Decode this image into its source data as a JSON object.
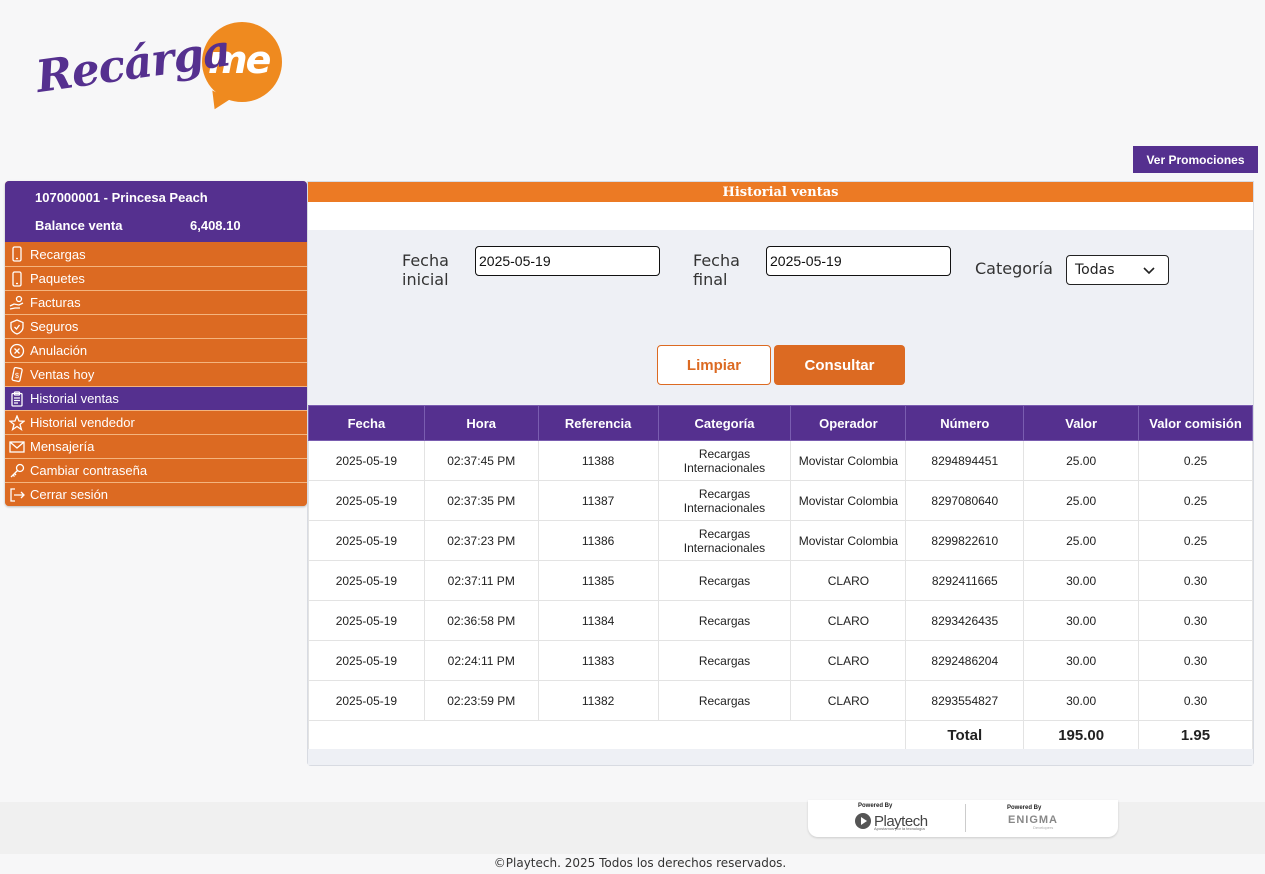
{
  "brand": {
    "logo_main": "Recárga",
    "logo_accent": "me"
  },
  "header": {
    "promo_button": "Ver Promociones"
  },
  "sidebar": {
    "account": "107000001 - Princesa Peach",
    "balance_label": "Balance venta",
    "balance_value": "6,408.10",
    "items": [
      {
        "label": "Recargas",
        "icon": "phone-icon"
      },
      {
        "label": "Paquetes",
        "icon": "phone-icon"
      },
      {
        "label": "Facturas",
        "icon": "hand-money-icon"
      },
      {
        "label": "Seguros",
        "icon": "shield-icon"
      },
      {
        "label": "Anulación",
        "icon": "circle-x-icon"
      },
      {
        "label": "Ventas hoy",
        "icon": "money-hand-icon"
      },
      {
        "label": "Historial ventas",
        "icon": "clipboard-icon",
        "active": true
      },
      {
        "label": "Historial vendedor",
        "icon": "star-icon"
      },
      {
        "label": "Mensajería",
        "icon": "envelope-icon"
      },
      {
        "label": "Cambiar contraseña",
        "icon": "key-icon"
      },
      {
        "label": "Cerrar sesión",
        "icon": "logout-icon"
      }
    ]
  },
  "panel": {
    "title": "Historial ventas",
    "filters": {
      "start_label_1": "Fecha",
      "start_label_2": "inicial",
      "start_value": "2025-05-19",
      "end_label_1": "Fecha",
      "end_label_2": "final",
      "end_value": "2025-05-19",
      "category_label": "Categoría",
      "category_value": "Todas"
    },
    "buttons": {
      "clear": "Limpiar",
      "query": "Consultar"
    }
  },
  "table": {
    "headers": [
      "Fecha",
      "Hora",
      "Referencia",
      "Categoría",
      "Operador",
      "Número",
      "Valor",
      "Valor comisión"
    ],
    "rows": [
      [
        "2025-05-19",
        "02:37:45 PM",
        "11388",
        "Recargas Internacionales",
        "Movistar Colombia",
        "8294894451",
        "25.00",
        "0.25"
      ],
      [
        "2025-05-19",
        "02:37:35 PM",
        "11387",
        "Recargas Internacionales",
        "Movistar Colombia",
        "8297080640",
        "25.00",
        "0.25"
      ],
      [
        "2025-05-19",
        "02:37:23 PM",
        "11386",
        "Recargas Internacionales",
        "Movistar Colombia",
        "8299822610",
        "25.00",
        "0.25"
      ],
      [
        "2025-05-19",
        "02:37:11 PM",
        "11385",
        "Recargas",
        "CLARO",
        "8292411665",
        "30.00",
        "0.30"
      ],
      [
        "2025-05-19",
        "02:36:58 PM",
        "11384",
        "Recargas",
        "CLARO",
        "8293426435",
        "30.00",
        "0.30"
      ],
      [
        "2025-05-19",
        "02:24:11 PM",
        "11383",
        "Recargas",
        "CLARO",
        "8292486204",
        "30.00",
        "0.30"
      ],
      [
        "2025-05-19",
        "02:23:59 PM",
        "11382",
        "Recargas",
        "CLARO",
        "8293554827",
        "30.00",
        "0.30"
      ]
    ],
    "total_label": "Total",
    "total_value": "195.00",
    "total_commission": "1.95"
  },
  "footer": {
    "powered_by_1": "Powered By",
    "playtech": "Playtech",
    "playtech_tagline": "Apostamos por la tecnología",
    "powered_by_2": "Powered By",
    "enigma": "ENIGMA",
    "enigma_tagline": "Developers",
    "copyright": "©Playtech. 2025 Todos los derechos reservados."
  },
  "colors": {
    "purple": "#55308f",
    "orange": "#dc6a22",
    "orange_light": "#ec7a24"
  }
}
